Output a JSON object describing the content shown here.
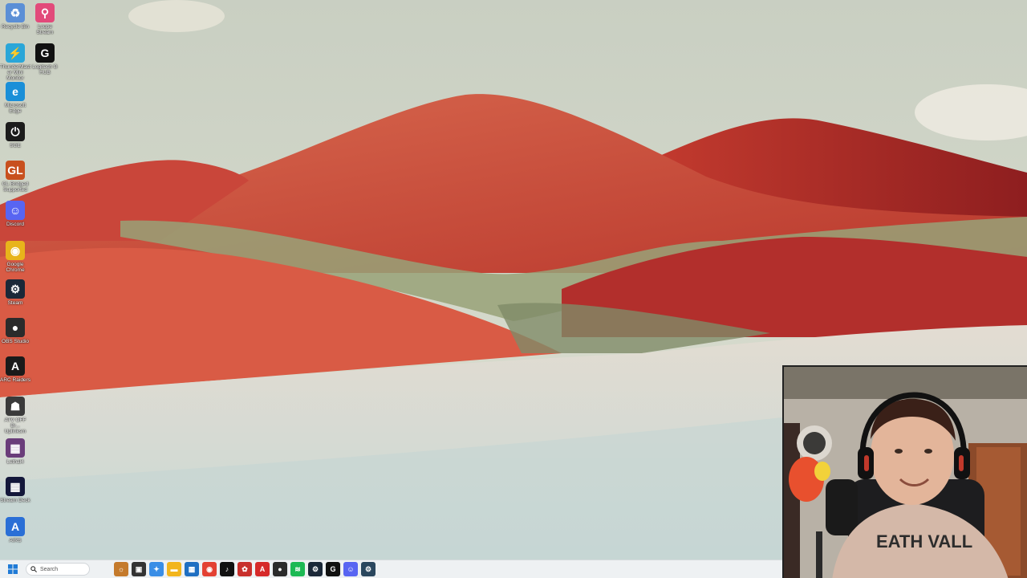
{
  "desktop": {
    "icons": [
      {
        "label": "Recycle Bin",
        "icon": "recycle-bin-icon",
        "color": "#5b8fd6",
        "glyph": "♻"
      },
      {
        "label": "Loupe Stream",
        "icon": "map-pin-icon",
        "color": "#e24a7a",
        "glyph": "⚲"
      },
      {
        "label": "ThunderMaster Mini Monitor",
        "icon": "thunder-icon",
        "color": "#2aa6d8",
        "glyph": "⚡"
      },
      {
        "label": "Logitech G HUB",
        "icon": "logitech-g-icon",
        "color": "#111111",
        "glyph": "G"
      },
      {
        "label": "Microsoft Edge",
        "icon": "edge-icon",
        "color": "#1a8fd8",
        "glyph": "e"
      },
      {
        "label": "SGE",
        "icon": "power-icon",
        "color": "#1c1c1c",
        "glyph": "⏻"
      },
      {
        "label": "GL Bridged Supported",
        "icon": "gl-icon",
        "color": "#c8501e",
        "glyph": "GL"
      },
      {
        "label": "Discord",
        "icon": "discord-icon",
        "color": "#5865f2",
        "glyph": "☺"
      },
      {
        "label": "Google Chrome",
        "icon": "chrome-icon",
        "color": "#e8b41b",
        "glyph": "◉"
      },
      {
        "label": "Steam",
        "icon": "steam-icon",
        "color": "#1b2838",
        "glyph": "⚙"
      },
      {
        "label": "OBS Studio",
        "icon": "obs-icon",
        "color": "#2b2b2b",
        "glyph": "●"
      },
      {
        "label": "ARC Raiders",
        "icon": "arc-raiders-icon",
        "color": "#1a1a1a",
        "glyph": "A"
      },
      {
        "label": "ATV OFF Br... Uplinksm",
        "icon": "game-icon",
        "color": "#3a3a3a",
        "glyph": "☗"
      },
      {
        "label": "Lethal4",
        "icon": "game-cover-icon",
        "color": "#6a3d7a",
        "glyph": "▦"
      },
      {
        "label": "Stream Deck",
        "icon": "stream-deck-icon",
        "color": "#13173a",
        "glyph": "▦"
      },
      {
        "label": "AIRS",
        "icon": "font-a-icon",
        "color": "#2a6fd6",
        "glyph": "A"
      }
    ]
  },
  "taskbar": {
    "search_placeholder": "Search",
    "pinned": [
      {
        "name": "widgets-icon",
        "color": "#c47a2c",
        "glyph": "☼"
      },
      {
        "name": "task-view-icon",
        "color": "#333333",
        "glyph": "▣"
      },
      {
        "name": "copilot-icon",
        "color": "#3a8ee6",
        "glyph": "✦"
      },
      {
        "name": "file-explorer-icon",
        "color": "#f2b51d",
        "glyph": "▬"
      },
      {
        "name": "store-icon",
        "color": "#1f6fc2",
        "glyph": "▦"
      },
      {
        "name": "chrome-icon",
        "color": "#e34133",
        "glyph": "◉"
      },
      {
        "name": "tiktok-icon",
        "color": "#111111",
        "glyph": "♪"
      },
      {
        "name": "davinci-icon",
        "color": "#c8302c",
        "glyph": "✿"
      },
      {
        "name": "adobe-icon",
        "color": "#d62a2a",
        "glyph": "A"
      },
      {
        "name": "obs-icon",
        "color": "#2b2b2b",
        "glyph": "●"
      },
      {
        "name": "spotify-icon",
        "color": "#1db954",
        "glyph": "≋"
      },
      {
        "name": "steam-icon",
        "color": "#1b2838",
        "glyph": "⚙"
      },
      {
        "name": "logitech-g-icon",
        "color": "#111111",
        "glyph": "G"
      },
      {
        "name": "discord-icon",
        "color": "#5865f2",
        "glyph": "☺"
      },
      {
        "name": "steam-alt-icon",
        "color": "#2a475e",
        "glyph": "⚙"
      }
    ]
  }
}
